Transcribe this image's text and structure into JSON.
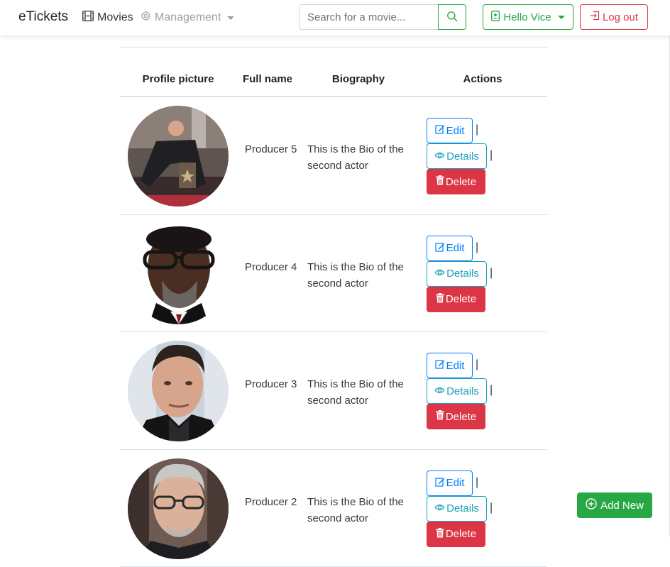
{
  "navbar": {
    "brand": "eTickets",
    "movies_label": "Movies",
    "movies_icon": "film-icon",
    "management_label": "Management",
    "management_icon": "gear-icon",
    "search_placeholder": "Search for a movie...",
    "search_icon": "search-icon",
    "user_label": "Hello Vice",
    "user_icon": "user-badge-icon",
    "logout_label": "Log out",
    "logout_icon": "logout-icon"
  },
  "table": {
    "headers": {
      "picture": "Profile picture",
      "name": "Full name",
      "bio": "Biography",
      "actions": "Actions"
    },
    "rows": [
      {
        "name": "Producer 5",
        "bio": "This is the Bio of the second actor"
      },
      {
        "name": "Producer 4",
        "bio": "This is the Bio of the second actor"
      },
      {
        "name": "Producer 3",
        "bio": "This is the Bio of the second actor"
      },
      {
        "name": "Producer 2",
        "bio": "This is the Bio of the second actor"
      }
    ],
    "actions": {
      "edit": "Edit",
      "details": "Details",
      "delete": "Delete",
      "separator": "|"
    }
  },
  "add_new_label": "Add New",
  "colors": {
    "primary": "#007bff",
    "success": "#28a745",
    "danger": "#dc3545",
    "info": "#17a2b8"
  }
}
